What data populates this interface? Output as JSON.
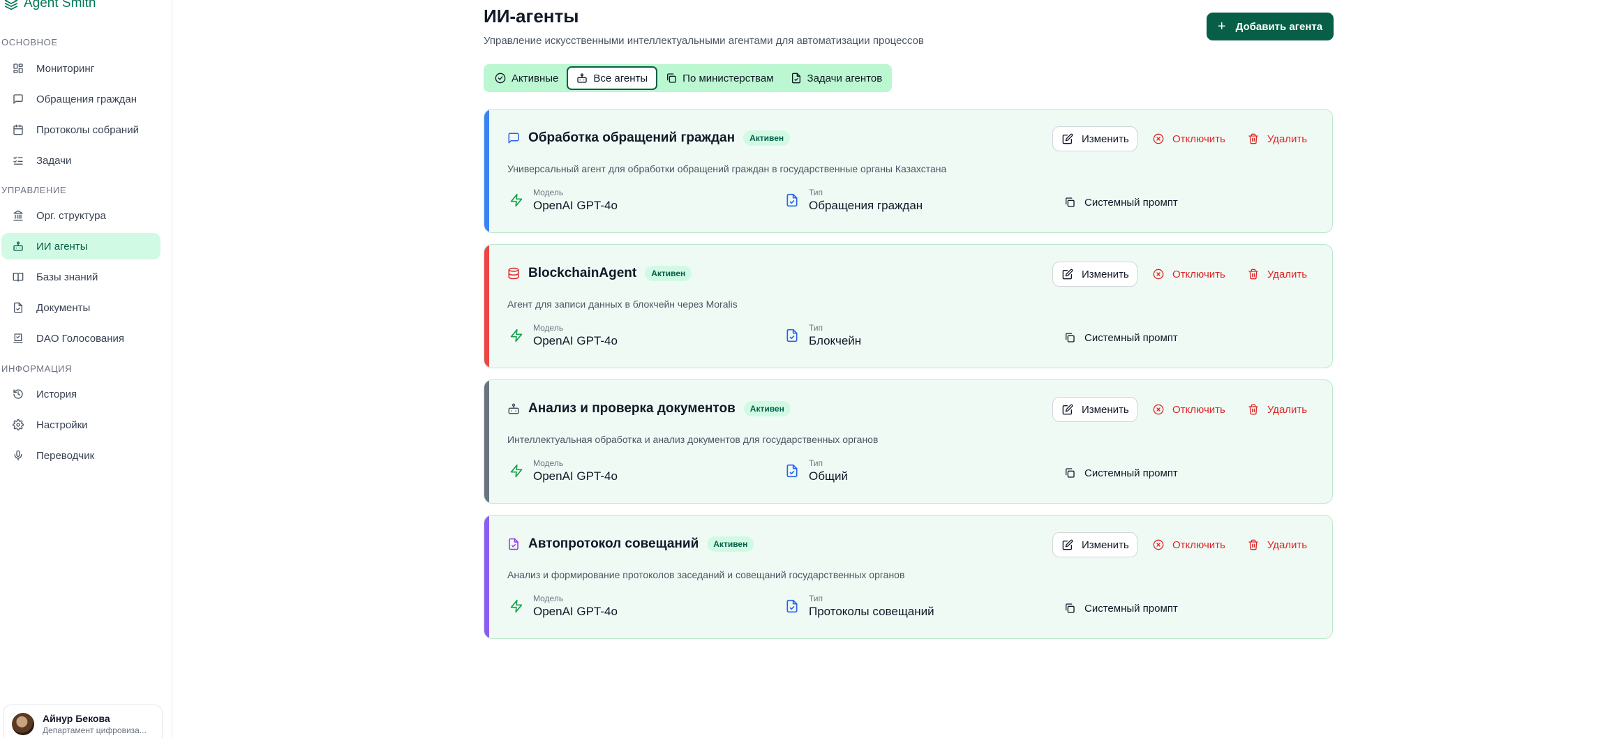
{
  "brand": {
    "name": "Agent Smith"
  },
  "sidebar": {
    "sections": [
      {
        "label": "Основное"
      },
      {
        "label": "Управление"
      },
      {
        "label": "Информация"
      }
    ],
    "items": [
      {
        "label": "Мониторинг",
        "icon": "dashboard-icon"
      },
      {
        "label": "Обращения граждан",
        "icon": "message-icon"
      },
      {
        "label": "Протоколы собраний",
        "icon": "calendar-icon"
      },
      {
        "label": "Задачи",
        "icon": "tasks-icon"
      },
      {
        "label": "Орг. структура",
        "icon": "building-icon"
      },
      {
        "label": "ИИ агенты",
        "icon": "bot-icon",
        "active": true
      },
      {
        "label": "Базы знаний",
        "icon": "book-icon"
      },
      {
        "label": "Документы",
        "icon": "file-icon"
      },
      {
        "label": "DAO Голосования",
        "icon": "vote-icon"
      },
      {
        "label": "История",
        "icon": "history-icon"
      },
      {
        "label": "Настройки",
        "icon": "gear-icon"
      },
      {
        "label": "Переводчик",
        "icon": "mic-icon"
      }
    ],
    "user": {
      "name": "Айнур Бекова",
      "department": "Департамент цифровиза..."
    }
  },
  "header": {
    "title": "ИИ-агенты",
    "subtitle": "Управление искусственными интеллектуальными агентами для автоматизации процессов",
    "add_button": "Добавить агента"
  },
  "tabs": [
    {
      "label": "Активные",
      "active": false
    },
    {
      "label": "Все агенты",
      "active": true
    },
    {
      "label": "По министерствам",
      "active": false
    },
    {
      "label": "Задачи агентов",
      "active": false
    }
  ],
  "labels": {
    "edit": "Изменить",
    "disable": "Отключить",
    "delete": "Удалить",
    "model": "Модель",
    "type": "Тип",
    "system_prompt": "Системный промпт"
  },
  "agents": [
    {
      "title": "Обработка обращений граждан",
      "status": "Активен",
      "description": "Универсальный агент для обработки обращений граждан в государственные органы Казахстана",
      "model": "OpenAI GPT-4o",
      "type": "Обращения граждан",
      "accent_color": "#3b82f6",
      "icon": "message-icon",
      "icon_color": "#2563eb"
    },
    {
      "title": "BlockchainAgent",
      "status": "Активен",
      "description": "Агент для записи данных в блокчейн через Moralis",
      "model": "OpenAI GPT-4o",
      "type": "Блокчейн",
      "accent_color": "#ef4444",
      "icon": "database-icon",
      "icon_color": "#dc2626"
    },
    {
      "title": "Анализ и проверка документов",
      "status": "Активен",
      "description": "Интеллектуальная обработка и анализ документов для государственных органов",
      "model": "OpenAI GPT-4o",
      "type": "Общий",
      "accent_color": "#6b7280",
      "icon": "bot-icon",
      "icon_color": "#4b5563"
    },
    {
      "title": "Автопротокол совещаний",
      "status": "Активен",
      "description": "Анализ и формирование протоколов заседаний и совещаний государственных органов",
      "model": "OpenAI GPT-4o",
      "type": "Протоколы совещаний",
      "accent_color": "#8b5cf6",
      "icon": "file-icon",
      "icon_color": "#9333ea"
    }
  ]
}
